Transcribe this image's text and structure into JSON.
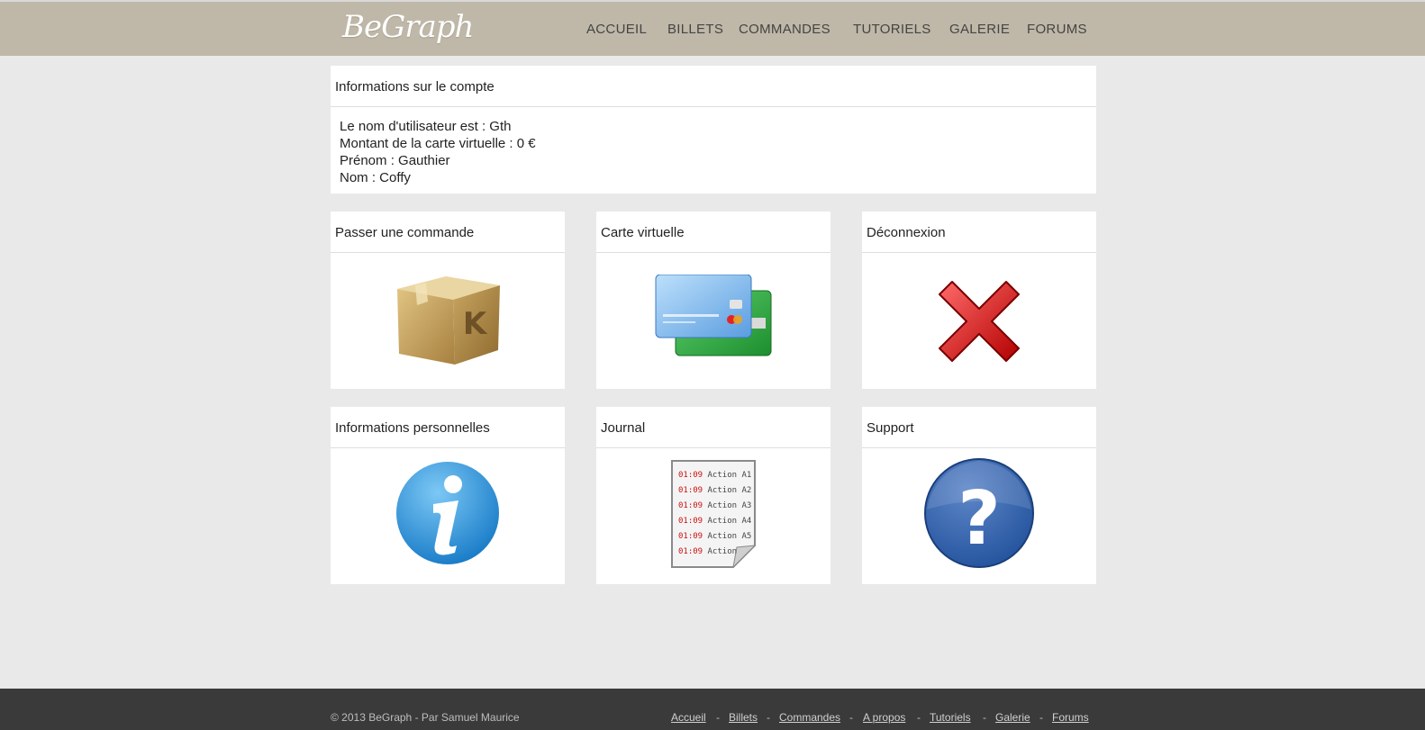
{
  "brand": {
    "logo_text": "BeGraph"
  },
  "nav": {
    "items": [
      {
        "label": "ACCUEIL"
      },
      {
        "label": "BILLETS"
      },
      {
        "label": "COMMANDES"
      },
      {
        "label": "TUTORIELS"
      },
      {
        "label": "GALERIE"
      },
      {
        "label": "FORUMS"
      }
    ]
  },
  "account": {
    "title": "Informations sur le compte",
    "lines": [
      "Le nom d'utilisateur est : Gth",
      "Montant de la carte virtuelle : 0 €",
      "Prénom : Gauthier",
      "Nom : Coffy"
    ]
  },
  "tiles": [
    {
      "title": "Passer une commande",
      "icon": "package-box-icon"
    },
    {
      "title": "Carte virtuelle",
      "icon": "credit-cards-icon"
    },
    {
      "title": "Déconnexion",
      "icon": "red-x-icon"
    },
    {
      "title": "Informations personnelles",
      "icon": "info-icon"
    },
    {
      "title": "Journal",
      "icon": "log-document-icon",
      "log_lines": [
        {
          "time": "01:09",
          "action": "Action A1"
        },
        {
          "time": "01:09",
          "action": "Action A2"
        },
        {
          "time": "01:09",
          "action": "Action A3"
        },
        {
          "time": "01:09",
          "action": "Action A4"
        },
        {
          "time": "01:09",
          "action": "Action A5"
        },
        {
          "time": "01:09",
          "action": "Action"
        }
      ]
    },
    {
      "title": "Support",
      "icon": "help-question-icon"
    }
  ],
  "footer": {
    "copyright": "© 2013 BeGraph - Par Samuel Maurice",
    "links": [
      {
        "label": "Accueil"
      },
      {
        "label": "Billets"
      },
      {
        "label": "Commandes"
      },
      {
        "label": "A propos"
      },
      {
        "label": "Tutoriels"
      },
      {
        "label": "Galerie"
      },
      {
        "label": "Forums"
      }
    ],
    "separator": "-"
  },
  "colors": {
    "header_bg": "#bfb8a8",
    "page_bg": "#e9e9e9",
    "footer_bg": "#3a3a3a",
    "log_time": "#cc1111"
  }
}
